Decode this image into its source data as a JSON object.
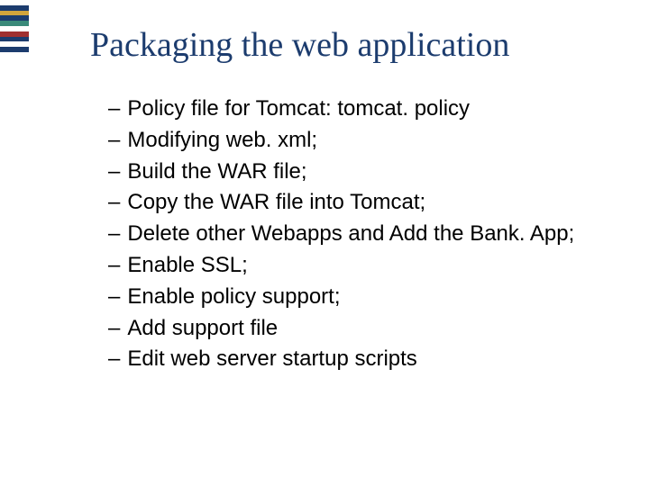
{
  "title": "Packaging the web application",
  "bullets": {
    "items": [
      {
        "text": "Policy file for Tomcat: tomcat. policy"
      },
      {
        "text": "Modifying web. xml;"
      },
      {
        "text": "Build the WAR file;"
      },
      {
        "text": "Copy the WAR file into Tomcat;"
      },
      {
        "text": "Delete other Webapps and Add the Bank. App;"
      },
      {
        "text": "Enable SSL;"
      },
      {
        "text": "Enable policy support;"
      },
      {
        "text": "Add support file"
      },
      {
        "text": "Edit web server startup scripts"
      }
    ]
  },
  "dash": "–"
}
